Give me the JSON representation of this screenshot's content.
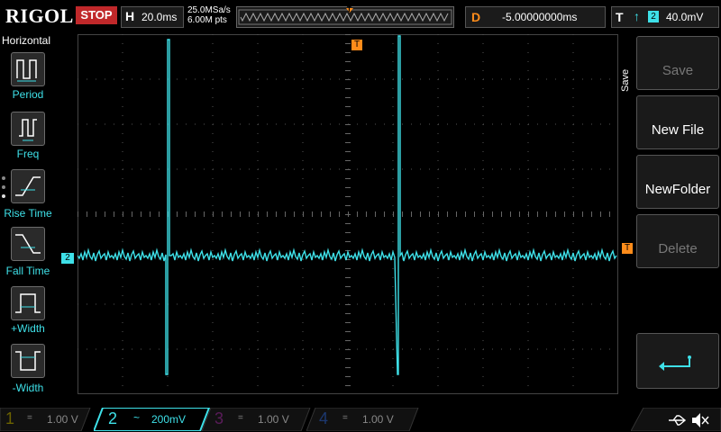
{
  "topbar": {
    "logo": "RIGOL",
    "status": "STOP",
    "timebase_label": "H",
    "timebase_value": "20.0ms",
    "sample_rate": "25.0MSa/s",
    "memory_depth": "6.00M pts",
    "trigger_marker": "T",
    "delay_label": "D",
    "delay_value": "-5.00000000ms",
    "trigger_label": "T",
    "trigger_edge": "↑",
    "trigger_channel": "2",
    "trigger_level": "40.0mV"
  },
  "left_menu": {
    "title": "Horizontal",
    "items": [
      {
        "label": "Period"
      },
      {
        "label": "Freq"
      },
      {
        "label": "Rise Time"
      },
      {
        "label": "Fall Time"
      },
      {
        "label": "+Width"
      },
      {
        "label": "-Width"
      }
    ]
  },
  "right_menu": {
    "tab": "Save",
    "items": [
      {
        "label": "Save",
        "enabled": false
      },
      {
        "label": "New File",
        "enabled": true
      },
      {
        "label": "NewFolder",
        "enabled": true
      },
      {
        "label": "Delete",
        "enabled": false
      }
    ]
  },
  "screen": {
    "ch2_marker": "2",
    "trig_level_marker": "T",
    "trig_pos_marker": "T"
  },
  "channels": [
    {
      "num": "1",
      "coupling": "=",
      "scale": "1.00 V",
      "color": "#c8b400",
      "active": false
    },
    {
      "num": "2",
      "coupling": "~",
      "scale": "200mV",
      "color": "#3ee0e8",
      "active": true
    },
    {
      "num": "3",
      "coupling": "=",
      "scale": "1.00 V",
      "color": "#c040c0",
      "active": false
    },
    {
      "num": "4",
      "coupling": "=",
      "scale": "1.00 V",
      "color": "#3070e0",
      "active": false
    }
  ],
  "colors": {
    "trace": "#3ee0e8",
    "accent": "#ff8c1a",
    "stop": "#c0282a"
  }
}
